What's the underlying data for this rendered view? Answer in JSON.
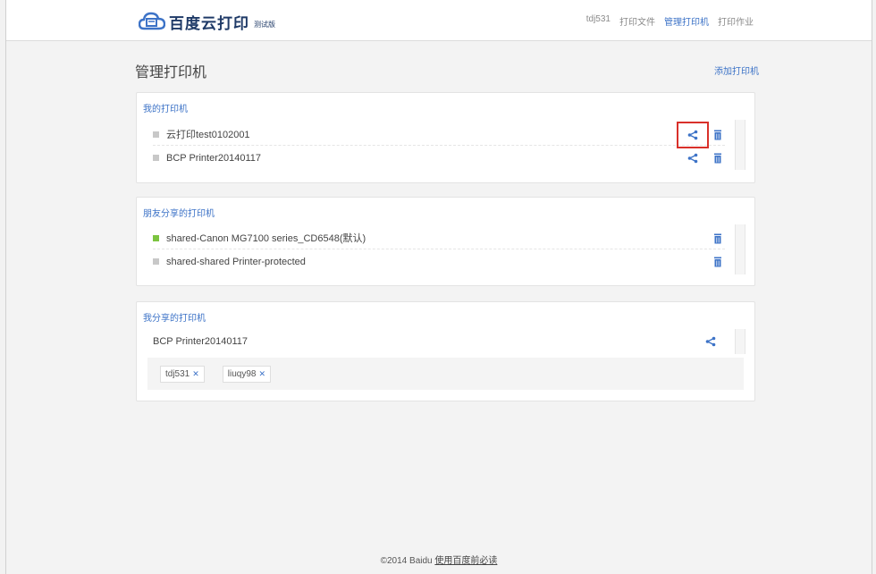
{
  "header": {
    "logo_text": "百度云打印",
    "logo_badge": "测试版",
    "nav": [
      {
        "label": "tdj531"
      },
      {
        "label": "打印文件"
      },
      {
        "label": "管理打印机"
      },
      {
        "label": "打印作业"
      }
    ]
  },
  "page": {
    "title": "管理打印机",
    "add_printer": "添加打印机"
  },
  "my_printers": {
    "title": "我的打印机",
    "items": [
      {
        "name": "云打印test0102001"
      },
      {
        "name": "BCP Printer20140117"
      }
    ]
  },
  "shared_with_me": {
    "title": "朋友分享的打印机",
    "items": [
      {
        "name": "shared-Canon MG7100 series_CD6548(默认)",
        "status": "online"
      },
      {
        "name": "shared-shared Printer-protected",
        "status": "offline"
      }
    ]
  },
  "i_shared": {
    "title": "我分享的打印机",
    "printer": "BCP Printer20140117",
    "recipients": [
      {
        "name": "tdj531"
      },
      {
        "name": "liuqy98"
      }
    ]
  },
  "footer": {
    "copyright": "©2014 Baidu",
    "link": "使用百度前必读"
  },
  "colors": {
    "accent": "#3d73c7",
    "online": "#7cc440",
    "highlight": "#d9302a"
  }
}
